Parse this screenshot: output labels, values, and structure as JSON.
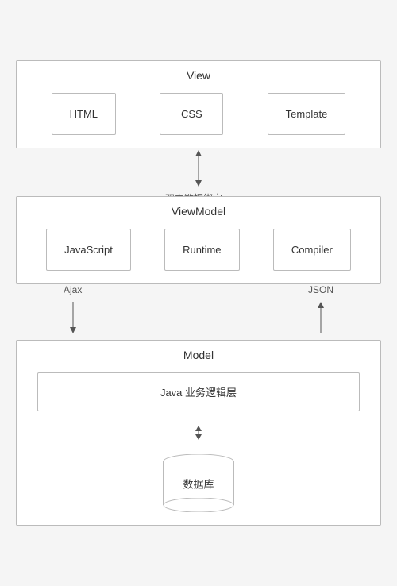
{
  "view": {
    "title": "View",
    "items": [
      {
        "label": "HTML"
      },
      {
        "label": "CSS"
      },
      {
        "label": "Template"
      }
    ]
  },
  "arrow_middle": {
    "label": "双向数据绑定。"
  },
  "viewmodel": {
    "title": "ViewModel",
    "items": [
      {
        "label": "JavaScript"
      },
      {
        "label": "Runtime"
      },
      {
        "label": "Compiler"
      }
    ]
  },
  "arrow_bottom_left": {
    "label": "Ajax"
  },
  "arrow_bottom_right": {
    "label": "JSON"
  },
  "model": {
    "title": "Model",
    "java_label": "Java 业务逻辑层",
    "db_label": "数据库"
  }
}
